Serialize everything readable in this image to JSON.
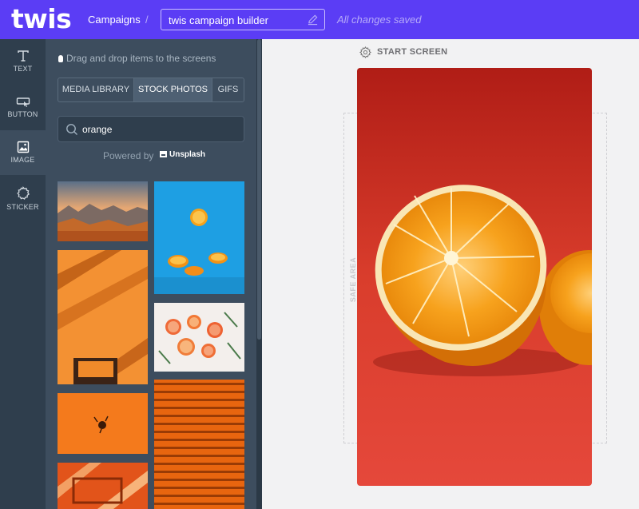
{
  "app": {
    "logo": "twis",
    "brand_color": "#5b3df5"
  },
  "header": {
    "breadcrumb": "Campaigns",
    "separator": "/",
    "campaign_title": "twis campaign builder",
    "save_status": "All changes saved"
  },
  "rail": {
    "items": [
      {
        "label": "TEXT",
        "icon": "text-icon"
      },
      {
        "label": "BUTTON",
        "icon": "button-icon"
      },
      {
        "label": "IMAGE",
        "icon": "image-icon",
        "active": true
      },
      {
        "label": "STICKER",
        "icon": "sticker-icon"
      }
    ]
  },
  "panel": {
    "hint": "Drag and drop items to the screens",
    "tabs": [
      {
        "label": "MEDIA LIBRARY"
      },
      {
        "label": "STOCK PHOTOS",
        "active": true
      },
      {
        "label": "GIFS"
      }
    ],
    "search": {
      "value": "orange"
    },
    "powered_by": "Powered by",
    "provider": "Unsplash"
  },
  "canvas": {
    "screen_label": "START SCREEN",
    "safe_area_label": "SAFE AREA"
  }
}
